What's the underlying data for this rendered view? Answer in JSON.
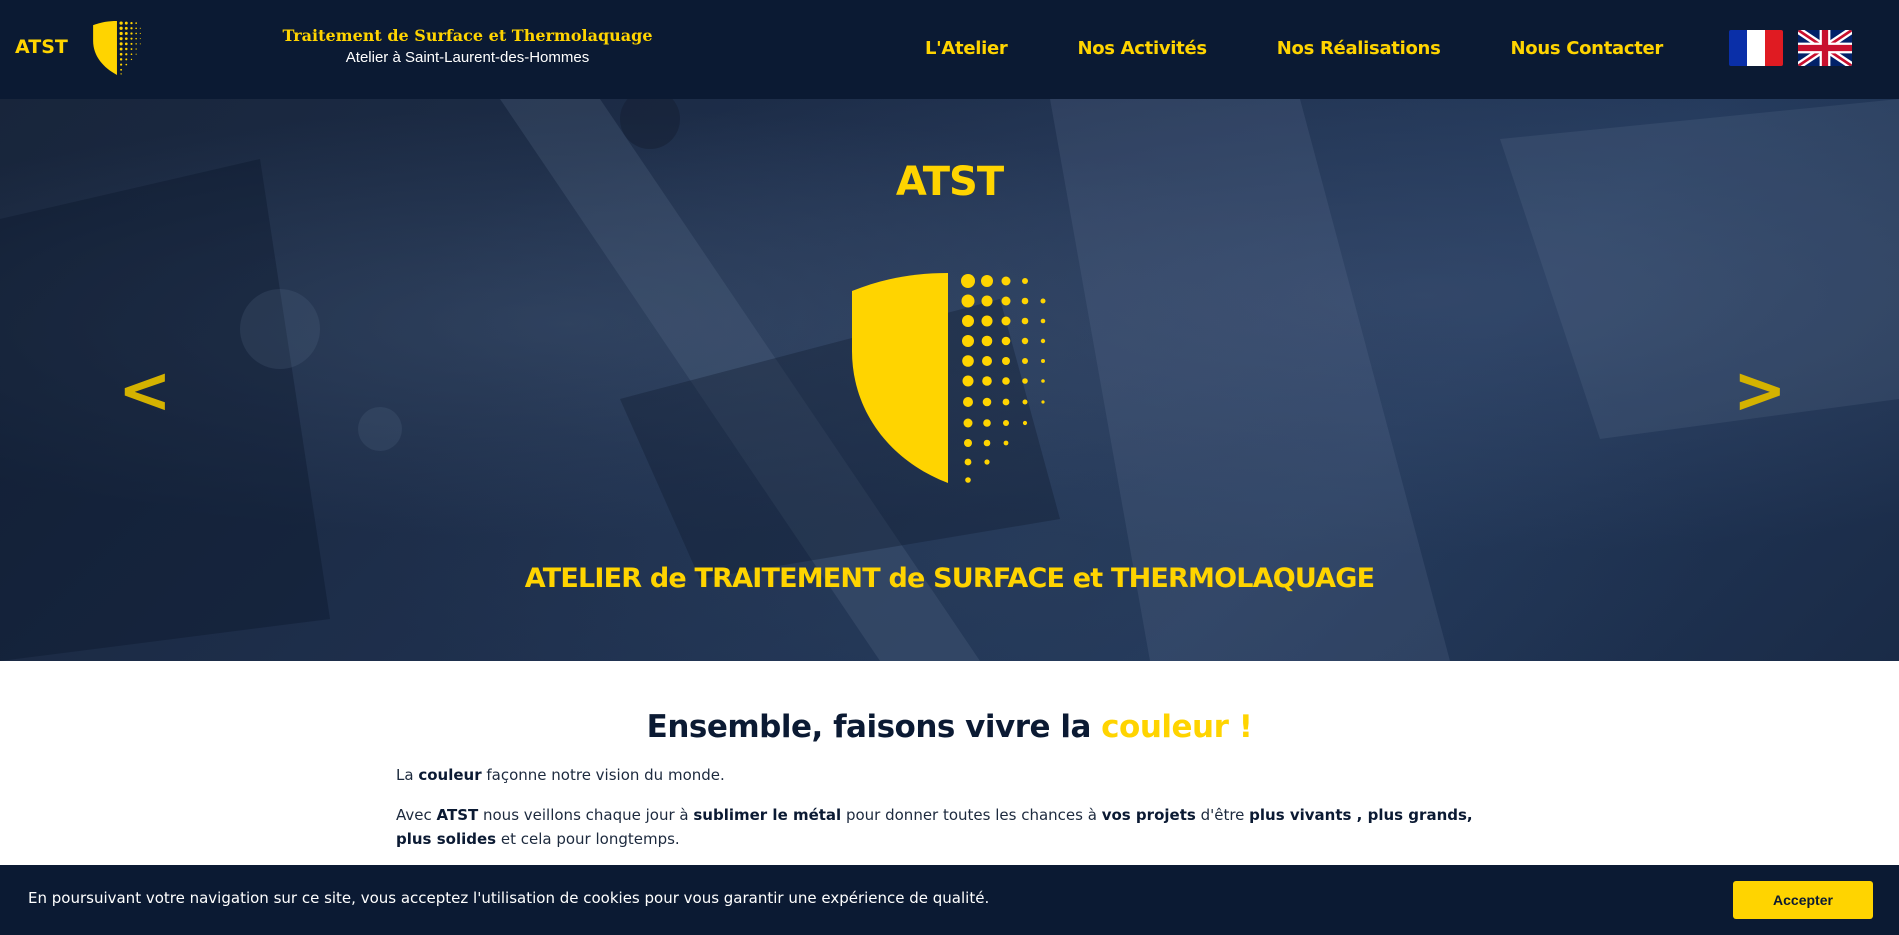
{
  "header": {
    "brand": "ATST",
    "tagline_line1": "Traitement de Surface et Thermolaquage",
    "tagline_line2": "Atelier à Saint-Laurent-des-Hommes",
    "nav": [
      "L'Atelier",
      "Nos Activités",
      "Nos Réalisations",
      "Nous Contacter"
    ],
    "languages": [
      "fr-flag-icon",
      "uk-flag-icon"
    ]
  },
  "hero": {
    "title": "ATST",
    "subtitle": "ATELIER de TRAITEMENT de SURFACE et THERMOLAQUAGE",
    "prev_label": "<",
    "next_label": ">"
  },
  "intro": {
    "heading_prefix": "Ensemble, faisons vivre la ",
    "heading_accent": "couleur !",
    "p1": [
      "La ",
      "couleur",
      " façonne notre vision du monde."
    ],
    "p2": [
      "Avec ",
      "ATST",
      " nous veillons chaque jour à ",
      "sublimer le métal",
      " pour donner toutes les chances à ",
      "vos projets",
      " d'être ",
      "plus vivants , plus grands, plus solides",
      " et cela pour longtemps."
    ]
  },
  "cookie": {
    "text": "En poursuivant votre navigation sur ce site, vous acceptez l'utilisation de cookies pour vous garantir une expérience de qualité.",
    "button": "Accepter"
  },
  "colors": {
    "navy": "#0b1a33",
    "yellow": "#ffd400"
  }
}
